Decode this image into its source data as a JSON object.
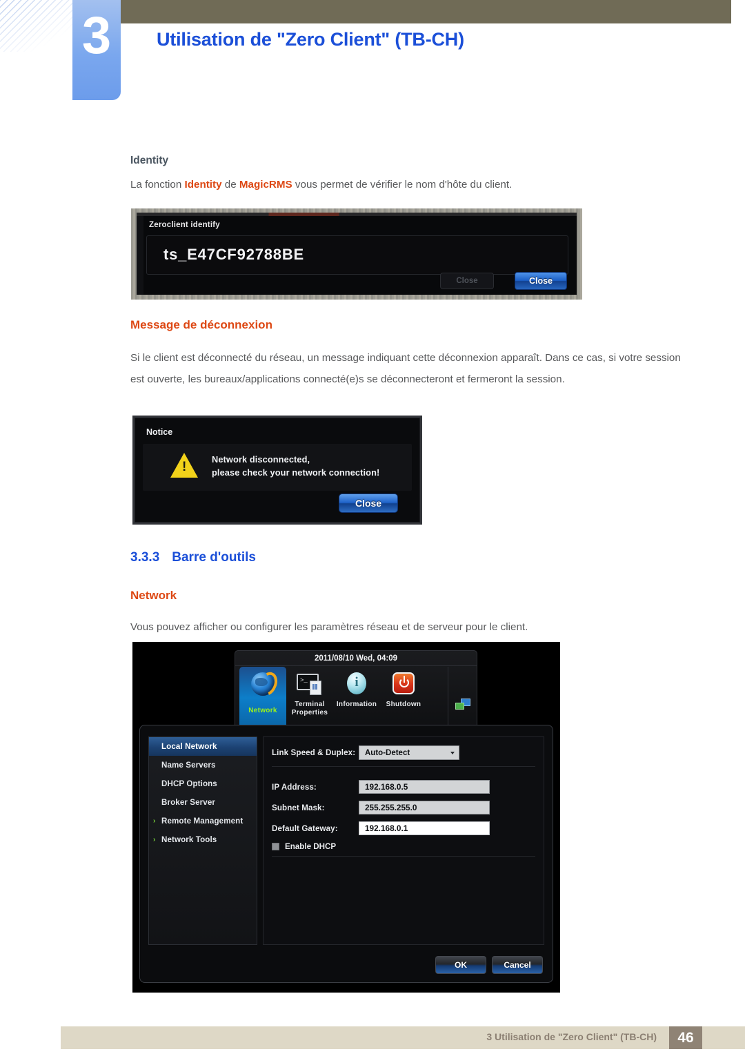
{
  "header": {
    "chapter_number": "3",
    "chapter_title": "Utilisation de \"Zero Client\" (TB-CH)"
  },
  "sections": {
    "identity_heading": "Identity",
    "identity_paragraph_1": "La fonction ",
    "identity_hl_1": "Identity",
    "identity_paragraph_2": " de ",
    "identity_hl_2": "MagicRMS",
    "identity_paragraph_3": " vous permet de vérifier le nom d'hôte du client.",
    "disconnect_heading": "Message de déconnexion",
    "disconnect_paragraph": "Si le client est déconnecté du réseau, un message indiquant cette déconnexion apparaît. Dans ce cas, si votre session est ouverte, les bureaux/applications connecté(e)s se déconnecteront et fermeront la session.",
    "toolbar_number": "3.3.3",
    "toolbar_heading": "Barre d'outils",
    "network_heading": "Network",
    "network_paragraph": "Vous pouvez afficher ou configurer les paramètres réseau et de serveur pour le client."
  },
  "identity_dialog": {
    "title": "Zeroclient identify",
    "hostname": "ts_E47CF92788BE",
    "close_dim_label": "Close",
    "close_label": "Close"
  },
  "notice_dialog": {
    "title": "Notice",
    "message_line1": "Network disconnected,",
    "message_line2": "please check your network connection!",
    "close_label": "Close",
    "warning_glyph": "!"
  },
  "network_shot": {
    "toolbar": {
      "datetime": "2011/08/10 Wed, 04:09",
      "items": [
        {
          "label": "Network",
          "icon": "globe-icon",
          "selected": true
        },
        {
          "label": "Terminal\nProperties",
          "label_line1": "Terminal",
          "label_line2": "Properties",
          "icon": "terminal-icon",
          "selected": false
        },
        {
          "label": "Information",
          "icon": "info-icon",
          "selected": false
        },
        {
          "label": "Shutdown",
          "icon": "power-icon",
          "selected": false
        }
      ],
      "tray_icon": "windows-icon",
      "handle_glyph": "▲"
    },
    "sidebar": [
      {
        "label": "Local Network",
        "active": true,
        "arrow": ""
      },
      {
        "label": "Name Servers",
        "active": false,
        "arrow": ""
      },
      {
        "label": "DHCP Options",
        "active": false,
        "arrow": ""
      },
      {
        "label": "Broker Server",
        "active": false,
        "arrow": ""
      },
      {
        "label": "Remote Management",
        "active": false,
        "arrow": "›"
      },
      {
        "label": "Network Tools",
        "active": false,
        "arrow": "›"
      }
    ],
    "form": {
      "link_speed_label": "Link Speed & Duplex:",
      "link_speed_value": "Auto-Detect",
      "ip_label": "IP Address:",
      "ip_value": "192.168.0.5",
      "subnet_label": "Subnet Mask:",
      "subnet_value": "255.255.255.0",
      "gateway_label": "Default Gateway:",
      "gateway_value": "192.168.0.1",
      "dhcp_label": "Enable DHCP"
    },
    "buttons": {
      "ok": "OK",
      "cancel": "Cancel"
    }
  },
  "footer": {
    "text": "3 Utilisation de \"Zero Client\" (TB-CH)",
    "page_number": "46"
  },
  "colors": {
    "accent_blue": "#1b4fd8",
    "accent_orange": "#dd4814",
    "olive": "#706b56",
    "footer_beige": "#ded8c6",
    "footer_brown": "#8f8375"
  }
}
